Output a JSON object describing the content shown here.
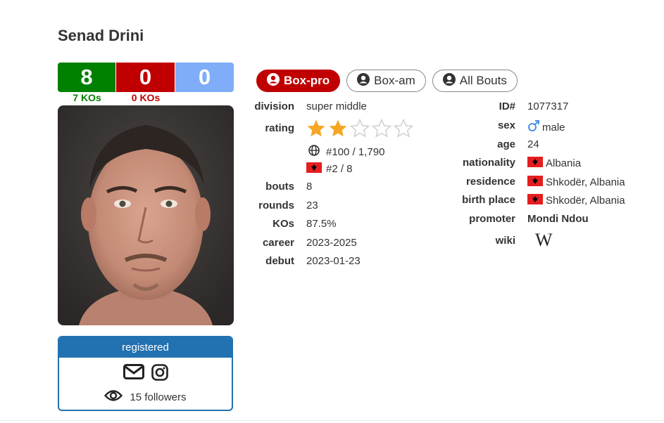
{
  "boxer": {
    "name": "Senad Drini"
  },
  "record": {
    "wins": "8",
    "losses": "0",
    "draws": "0",
    "wins_kos": "7 KOs",
    "losses_kos": "0 KOs"
  },
  "colors": {
    "win": "#008000",
    "loss": "#c00000",
    "draw": "#7fadf7",
    "accent": "#2271b1"
  },
  "registered": {
    "label": "registered",
    "followers": "15 followers",
    "icons": [
      "envelope-icon",
      "instagram-icon",
      "eye-icon"
    ]
  },
  "tabs": [
    {
      "label": "Box-pro",
      "icon": "user-circle-icon",
      "active": true
    },
    {
      "label": "Box-am",
      "icon": "user-circle-icon",
      "active": false
    },
    {
      "label": "All Bouts",
      "icon": "user-circle-icon",
      "active": false
    }
  ],
  "left": {
    "division": {
      "label": "division",
      "value": "super middle"
    },
    "rating": {
      "label": "rating",
      "stars_filled": 2,
      "stars_total": 5,
      "world": "#100 / 1,790",
      "national": "#2 / 8"
    },
    "bouts": {
      "label": "bouts",
      "value": "8"
    },
    "rounds": {
      "label": "rounds",
      "value": "23"
    },
    "kos": {
      "label": "KOs",
      "value": "87.5%"
    },
    "career": {
      "label": "career",
      "value": "2023-2025"
    },
    "debut": {
      "label": "debut",
      "value": "2023-01-23"
    }
  },
  "right": {
    "id": {
      "label": "ID#",
      "value": "1077317"
    },
    "sex": {
      "label": "sex",
      "value": "male",
      "icon": "male-icon"
    },
    "age": {
      "label": "age",
      "value": "24"
    },
    "nationality": {
      "label": "nationality",
      "value": "Albania",
      "flag": "albania-flag"
    },
    "residence": {
      "label": "residence",
      "value": "Shkodër, Albania"
    },
    "birth_place": {
      "label": "birth place",
      "value": "Shkodër, Albania"
    },
    "promoter": {
      "label": "promoter",
      "value": "Mondi Ndou"
    },
    "wiki": {
      "label": "wiki",
      "icon": "wikipedia-icon",
      "glyph": "W"
    }
  }
}
